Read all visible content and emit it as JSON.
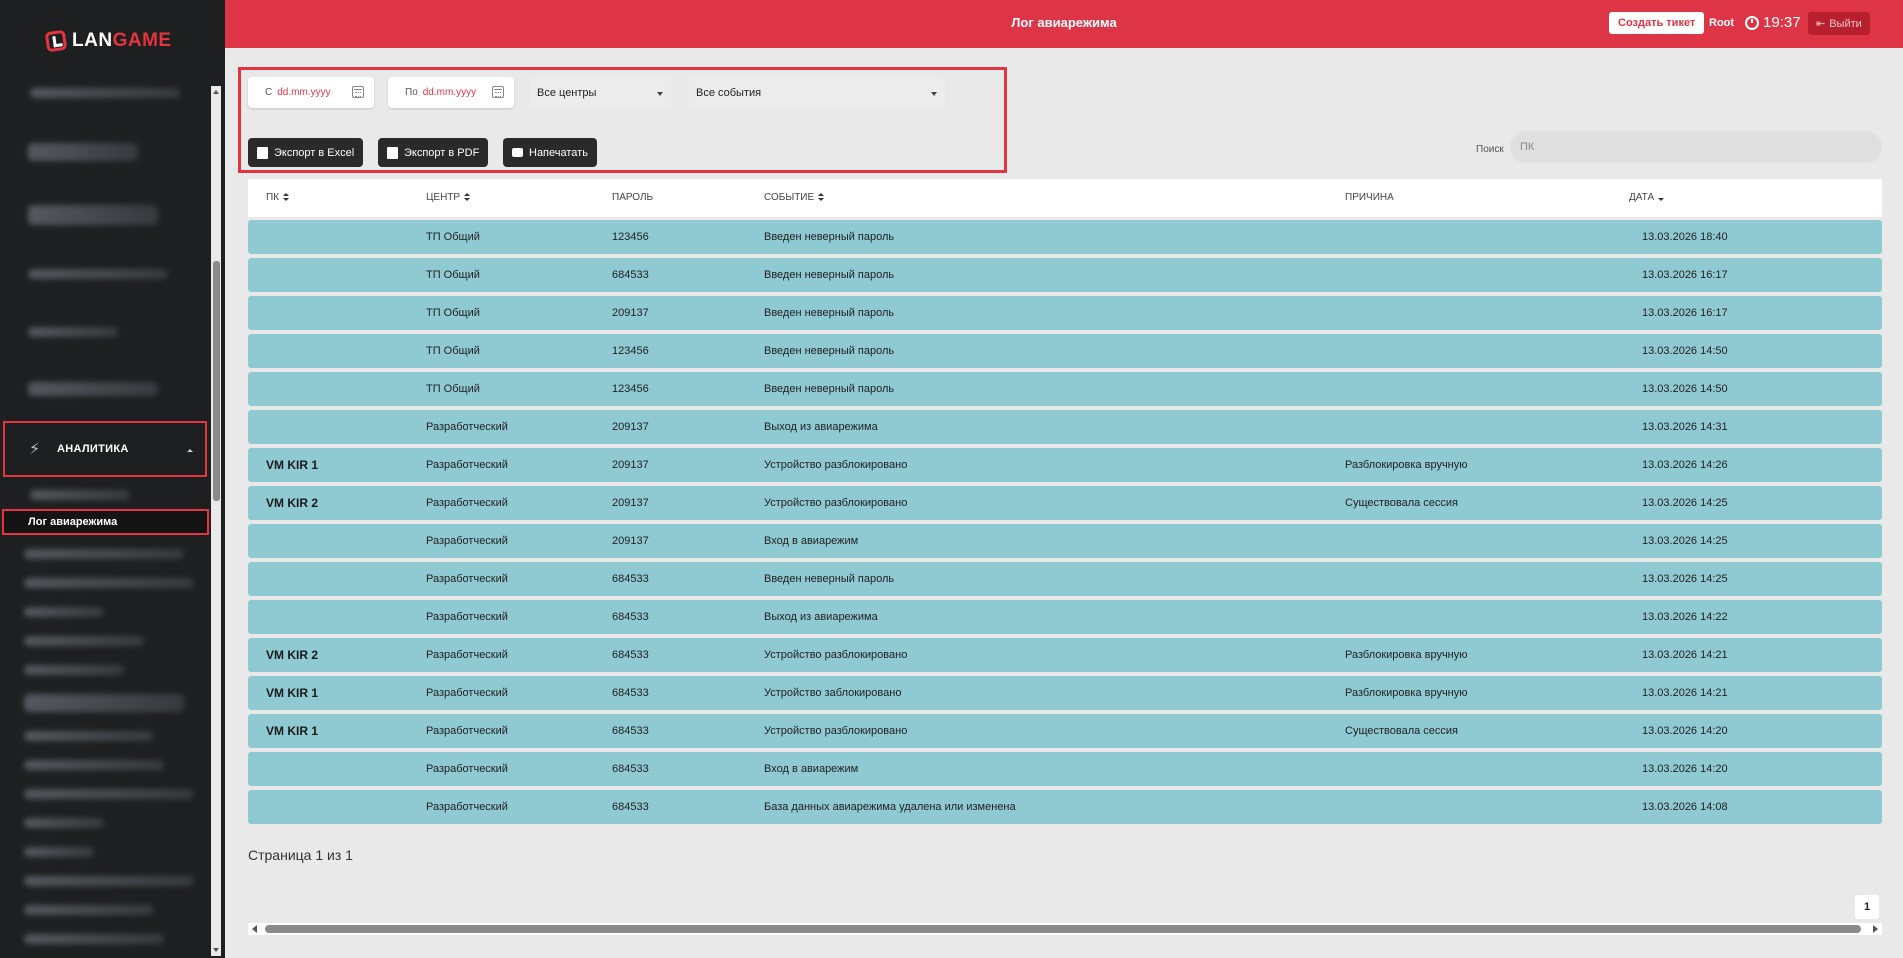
{
  "brand": {
    "lan": "LAN",
    "game": "GAME"
  },
  "sidebar": {
    "section_label": "АНАЛИТИКА",
    "active_item": "Лог авиарежима"
  },
  "header": {
    "title": "Лог авиарежима",
    "ticket_button": "Создать тикет",
    "user": "Root",
    "time": "19:37",
    "logout_button": "Выйти"
  },
  "filters": {
    "from_prefix": "С",
    "from_value": "dd.mm.yyyy",
    "to_prefix": "По",
    "to_value": "dd.mm.yyyy",
    "centers_select": "Все центры",
    "events_select": "Все события",
    "export_excel": "Экспорт в Excel",
    "export_pdf": "Экспорт в PDF",
    "print": "Напечатать"
  },
  "search": {
    "label": "Поиск",
    "placeholder": "ПК"
  },
  "table": {
    "headers": {
      "pc": "ПК",
      "center": "ЦЕНТР",
      "password": "ПАРОЛЬ",
      "event": "СОБЫТИЕ",
      "reason": "ПРИЧИНА",
      "date": "ДАТА"
    },
    "rows": [
      {
        "pc": "",
        "center": "ТП Общий",
        "password": "123456",
        "event": "Введен неверный пароль",
        "reason": "",
        "date": "13.03.2026 18:40"
      },
      {
        "pc": "",
        "center": "ТП Общий",
        "password": "684533",
        "event": "Введен неверный пароль",
        "reason": "",
        "date": "13.03.2026 16:17"
      },
      {
        "pc": "",
        "center": "ТП Общий",
        "password": "209137",
        "event": "Введен неверный пароль",
        "reason": "",
        "date": "13.03.2026 16:17"
      },
      {
        "pc": "",
        "center": "ТП Общий",
        "password": "123456",
        "event": "Введен неверный пароль",
        "reason": "",
        "date": "13.03.2026 14:50"
      },
      {
        "pc": "",
        "center": "ТП Общий",
        "password": "123456",
        "event": "Введен неверный пароль",
        "reason": "",
        "date": "13.03.2026 14:50"
      },
      {
        "pc": "",
        "center": "Разработческий",
        "password": "209137",
        "event": "Выход из авиарежима",
        "reason": "",
        "date": "13.03.2026 14:31"
      },
      {
        "pc": "VM KIR 1",
        "center": "Разработческий",
        "password": "209137",
        "event": "Устройство разблокировано",
        "reason": "Разблокировка вручную",
        "date": "13.03.2026 14:26"
      },
      {
        "pc": "VM KIR 2",
        "center": "Разработческий",
        "password": "209137",
        "event": "Устройство разблокировано",
        "reason": "Существовала сессия",
        "date": "13.03.2026 14:25"
      },
      {
        "pc": "",
        "center": "Разработческий",
        "password": "209137",
        "event": "Вход в авиарежим",
        "reason": "",
        "date": "13.03.2026 14:25"
      },
      {
        "pc": "",
        "center": "Разработческий",
        "password": "684533",
        "event": "Введен неверный пароль",
        "reason": "",
        "date": "13.03.2026 14:25"
      },
      {
        "pc": "",
        "center": "Разработческий",
        "password": "684533",
        "event": "Выход из авиарежима",
        "reason": "",
        "date": "13.03.2026 14:22"
      },
      {
        "pc": "VM KIR 2",
        "center": "Разработческий",
        "password": "684533",
        "event": "Устройство разблокировано",
        "reason": "Разблокировка вручную",
        "date": "13.03.2026 14:21"
      },
      {
        "pc": "VM KIR 1",
        "center": "Разработческий",
        "password": "684533",
        "event": "Устройство заблокировано",
        "reason": "Разблокировка вручную",
        "date": "13.03.2026 14:21"
      },
      {
        "pc": "VM KIR 1",
        "center": "Разработческий",
        "password": "684533",
        "event": "Устройство разблокировано",
        "reason": "Существовала сессия",
        "date": "13.03.2026 14:20"
      },
      {
        "pc": "",
        "center": "Разработческий",
        "password": "684533",
        "event": "Вход в авиарежим",
        "reason": "",
        "date": "13.03.2026 14:20"
      },
      {
        "pc": "",
        "center": "Разработческий",
        "password": "684533",
        "event": "База данных авиарежима удалена или изменена",
        "reason": "",
        "date": "13.03.2026 14:08"
      }
    ]
  },
  "pagination": {
    "info": "Страница 1 из 1",
    "current": "1"
  },
  "colors": {
    "accent": "#dd3545",
    "row": "#8fc9d2",
    "sidebar": "#1e1f21"
  }
}
